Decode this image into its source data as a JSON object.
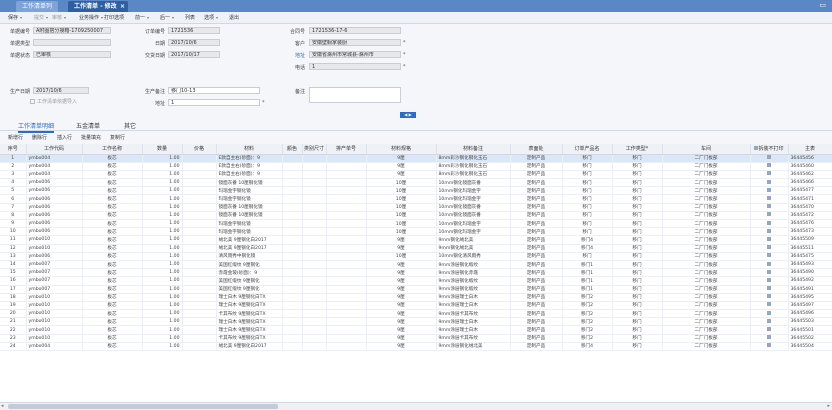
{
  "tabs": [
    {
      "label": "工作清单列表"
    },
    {
      "label": "工作清单 - 修改"
    }
  ],
  "toolbar": [
    {
      "label": "保存",
      "caret": true,
      "enabled": true
    },
    {
      "label": "提交",
      "caret": true,
      "enabled": false
    },
    {
      "label": "审核",
      "caret": true,
      "enabled": false
    },
    {
      "label": "业务操作",
      "caret": true,
      "enabled": true
    },
    {
      "label": "打印选项",
      "caret": false,
      "enabled": true
    },
    {
      "label": "前一",
      "caret": true,
      "enabled": true
    },
    {
      "label": "后一",
      "caret": true,
      "enabled": true
    },
    {
      "label": "列表",
      "caret": false,
      "enabled": true
    },
    {
      "label": "选项",
      "caret": true,
      "enabled": true
    },
    {
      "label": "退出",
      "caret": false,
      "enabled": true
    }
  ],
  "form": {
    "doc_no_label": "单据编号",
    "doc_no": "A附图搭分接箱-1709250007",
    "doc_type_label": "单据类型",
    "doc_type": "",
    "doc_status_label": "单据状态",
    "doc_status": "已审核",
    "order_no_label": "订单编号",
    "order_no": "1721536",
    "date_label": "日期",
    "date": "2017/10/6",
    "delivery_date_label": "交货日期",
    "delivery_date": "2017/10/17",
    "contract_no_label": "合同号",
    "contract_no": "1721536-17-6",
    "customer_label": "客户",
    "customer": "安徽壁橱家装厨",
    "address_label": "地址",
    "address": "安徽省滁州市常城县-滁州市",
    "phone_label": "电话",
    "phone": "1",
    "prod_date_label": "生产日期",
    "prod_date": "2017/10/6",
    "prod_remark_label": "生产备注",
    "prod_remark": "移门10-13",
    "site_label": "地址",
    "site": "1",
    "remark_label": "备注",
    "remark": "",
    "checkbox_label": "工作清单依据导入"
  },
  "subtabs": [
    {
      "label": "工作清单明细"
    },
    {
      "label": "五金清单"
    },
    {
      "label": "其它"
    }
  ],
  "row_tools": [
    {
      "label": "新增行"
    },
    {
      "label": "删除行"
    },
    {
      "label": "插入行"
    },
    {
      "label": "批量填充"
    },
    {
      "label": "复制行"
    }
  ],
  "columns": [
    "序号",
    "工作代码",
    "工作名称",
    "数量",
    "价格",
    "材料",
    "颜色",
    "类别尺寸",
    "排产单号",
    "材料规格",
    "材料备注",
    "表面处",
    "订单产品名",
    "工作类型*",
    "车间",
    "拆装不打印",
    "主表"
  ],
  "rows": [
    {
      "n": "1",
      "code": "ymbo004",
      "name": "板芯",
      "qty": "1.00",
      "mat": "E款自主右(砂面)：9",
      "spec": "9厘",
      "rem": "8mm彩沙钢化钢化玉石",
      "surf": "定制产品",
      "prod": "移门",
      "type": "移门",
      "ws": "二厂门板部",
      "chk": true,
      "id": "36445456"
    },
    {
      "n": "2",
      "code": "ymbo004",
      "name": "板芯",
      "qty": "1.00",
      "mat": "E款自主右(砂面)：9",
      "spec": "9厘",
      "rem": "8mm彩沙钢化钢化玉石",
      "surf": "定制产品",
      "prod": "移门",
      "type": "移门",
      "ws": "二厂门板部",
      "chk": true,
      "id": "36445460"
    },
    {
      "n": "3",
      "code": "ymbo004",
      "name": "板芯",
      "qty": "1.00",
      "mat": "E款自主右(砂面)：9",
      "spec": "9厘",
      "rem": "8mm彩沙钢化钢化玉石",
      "surf": "定制产品",
      "prod": "移门",
      "type": "移门",
      "ws": "二厂门板部",
      "chk": true,
      "id": "36445462"
    },
    {
      "n": "4",
      "code": "ymbo006",
      "name": "板芯",
      "qty": "1.00",
      "mat": "镜面灰番 10厘钢化镜",
      "spec": "10厘",
      "rem": "10mm钢化镜面灰番",
      "surf": "定制产品",
      "prod": "移门",
      "type": "移门",
      "ws": "二厂门板部",
      "chk": true,
      "id": "36445466"
    },
    {
      "n": "5",
      "code": "ymbo006",
      "name": "板芯",
      "qty": "1.00",
      "mat": "玛瑙金字钢化镜",
      "spec": "10厘",
      "rem": "10mm钢化玛瑙金字",
      "surf": "定制产品",
      "prod": "移门",
      "type": "移门",
      "ws": "二厂门板部",
      "chk": true,
      "id": "36445477"
    },
    {
      "n": "6",
      "code": "ymbo006",
      "name": "板芯",
      "qty": "1.00",
      "mat": "玛瑙金字钢化镜",
      "spec": "10厘",
      "rem": "10mm钢化玛瑙金字",
      "surf": "定制产品",
      "prod": "移门",
      "type": "移门",
      "ws": "二厂门板部",
      "chk": true,
      "id": "36445471"
    },
    {
      "n": "7",
      "code": "ymbo006",
      "name": "板芯",
      "qty": "1.00",
      "mat": "镜面灰番 10厘钢化镜",
      "spec": "10厘",
      "rem": "10mm钢化镜面灰番",
      "surf": "定制产品",
      "prod": "移门",
      "type": "移门",
      "ws": "二厂门板部",
      "chk": true,
      "id": "36445470"
    },
    {
      "n": "8",
      "code": "ymbo006",
      "name": "板芯",
      "qty": "1.00",
      "mat": "镜面灰番 10厘钢化镜",
      "spec": "10厘",
      "rem": "10mm钢化镜面灰番",
      "surf": "定制产品",
      "prod": "移门",
      "type": "移门",
      "ws": "二厂门板部",
      "chk": true,
      "id": "36445472"
    },
    {
      "n": "9",
      "code": "ymbo006",
      "name": "板芯",
      "qty": "1.00",
      "mat": "玛瑙金字钢化镜",
      "spec": "10厘",
      "rem": "10mm钢化玛瑙金字",
      "surf": "定制产品",
      "prod": "移门",
      "type": "移门",
      "ws": "二厂门板部",
      "chk": true,
      "id": "36445476"
    },
    {
      "n": "10",
      "code": "ymbo006",
      "name": "板芯",
      "qty": "1.00",
      "mat": "玛瑙金字钢化镜",
      "spec": "10厘",
      "rem": "10mm钢化玛瑙金字",
      "surf": "定制产品",
      "prod": "移门",
      "type": "移门",
      "ws": "二厂门板部",
      "chk": true,
      "id": "36445473"
    },
    {
      "n": "11",
      "code": "ymbo010",
      "name": "板芯",
      "qty": "1.00",
      "mat": "绒北美 9厘钢化白2017",
      "spec": "9厘",
      "rem": "9mm钢化绒北美",
      "surf": "定制产品",
      "prod": "移门4",
      "type": "移门",
      "ws": "二厂门板部",
      "chk": true,
      "id": "36445509"
    },
    {
      "n": "12",
      "code": "ymbo010",
      "name": "板芯",
      "qty": "1.00",
      "mat": "绒北美 9厘钢化白2017",
      "spec": "9厘",
      "rem": "9mm钢化绒北美",
      "surf": "定制产品",
      "prod": "移门4",
      "type": "移门",
      "ws": "二厂门板部",
      "chk": true,
      "id": "36445511"
    },
    {
      "n": "13",
      "code": "ymbo006",
      "name": "板芯",
      "qty": "1.00",
      "mat": "清风雨秀中钢化镜",
      "spec": "10厘",
      "rem": "10mm钢化清风雨秀",
      "surf": "定制产品",
      "prod": "移门",
      "type": "移门",
      "ws": "二厂门板部",
      "chk": true,
      "id": "36445475"
    },
    {
      "n": "14",
      "code": "ymbo007",
      "name": "板芯",
      "qty": "1.00",
      "mat": "美国红缎纹 9厘钢化",
      "spec": "9厘",
      "rem": "9mm涂层钢化缎纹",
      "surf": "定制产品",
      "prod": "移门1",
      "type": "移门",
      "ws": "二厂门板部",
      "chk": true,
      "id": "36445493"
    },
    {
      "n": "15",
      "code": "ymbo007",
      "name": "板芯",
      "qty": "1.00",
      "mat": "赤霞金玻(砂面)：9",
      "spec": "9厘",
      "rem": "9mm涂层钢化赤霞",
      "surf": "定制产品",
      "prod": "移门1",
      "type": "移门",
      "ws": "二厂门板部",
      "chk": true,
      "id": "36445490"
    },
    {
      "n": "16",
      "code": "ymbo007",
      "name": "板芯",
      "qty": "1.00",
      "mat": "美国红缎纹 9厘钢化",
      "spec": "9厘",
      "rem": "9mm涂层钢化缎纹",
      "surf": "定制产品",
      "prod": "移门1",
      "type": "移门",
      "ws": "二厂门板部",
      "chk": true,
      "id": "36445492"
    },
    {
      "n": "17",
      "code": "ymbo007",
      "name": "板芯",
      "qty": "1.00",
      "mat": "美国红缎纹 9厘钢化",
      "spec": "9厘",
      "rem": "9mm涂层钢化缎纹",
      "surf": "定制产品",
      "prod": "移门1",
      "type": "移门",
      "ws": "二厂门板部",
      "chk": true,
      "id": "36445491"
    },
    {
      "n": "18",
      "code": "ymbo010",
      "name": "板芯",
      "qty": "1.00",
      "mat": "瑞士白木 9厘钢化白TX",
      "spec": "9厘",
      "rem": "9mm涂层瑞士白木",
      "surf": "定制产品",
      "prod": "移门2",
      "type": "移门",
      "ws": "二厂门板部",
      "chk": true,
      "id": "36445495"
    },
    {
      "n": "19",
      "code": "ymbo010",
      "name": "板芯",
      "qty": "1.00",
      "mat": "瑞士白木 9厘钢化白TX",
      "spec": "9厘",
      "rem": "9mm涂层瑞士白木",
      "surf": "定制产品",
      "prod": "移门2",
      "type": "移门",
      "ws": "二厂门板部",
      "chk": true,
      "id": "36445497"
    },
    {
      "n": "20",
      "code": "ymbo010",
      "name": "板芯",
      "qty": "1.00",
      "mat": "卡其布纹 9厘钢化白TX",
      "spec": "9厘",
      "rem": "9mm涂层卡其布纹",
      "surf": "定制产品",
      "prod": "移门2",
      "type": "移门",
      "ws": "二厂门板部",
      "chk": true,
      "id": "36445496"
    },
    {
      "n": "21",
      "code": "ymbo010",
      "name": "板芯",
      "qty": "1.00",
      "mat": "瑞士白木 9厘钢化白TX",
      "spec": "9厘",
      "rem": "9mm涂层瑞士白木",
      "surf": "定制产品",
      "prod": "移门2",
      "type": "移门",
      "ws": "二厂门板部",
      "chk": true,
      "id": "36445503"
    },
    {
      "n": "22",
      "code": "ymbo010",
      "name": "板芯",
      "qty": "1.00",
      "mat": "瑞士白木 9厘钢化白TX",
      "spec": "9厘",
      "rem": "9mm涂层瑞士白木",
      "surf": "定制产品",
      "prod": "移门2",
      "type": "移门",
      "ws": "二厂门板部",
      "chk": true,
      "id": "36445501"
    },
    {
      "n": "23",
      "code": "ymbo010",
      "name": "板芯",
      "qty": "1.00",
      "mat": "卡其布纹 9厘钢化白TX",
      "spec": "9厘",
      "rem": "9mm涂层卡其布纹",
      "surf": "定制产品",
      "prod": "移门2",
      "type": "移门",
      "ws": "二厂门板部",
      "chk": true,
      "id": "36445502"
    },
    {
      "n": "24",
      "code": "ymbo004",
      "name": "板芯",
      "qty": "1.00",
      "mat": "绒北美 9厘钢化白2017",
      "spec": "9厘",
      "rem": "9mm涂层钢化绒北美",
      "surf": "定制产品",
      "prod": "移门4",
      "type": "移门",
      "ws": "二厂门板部",
      "chk": true,
      "id": "36445504"
    }
  ],
  "colors": {
    "accent": "#2b6cc4",
    "tabbar": "#5b87c7",
    "selected_row": "#dbe7f6"
  }
}
